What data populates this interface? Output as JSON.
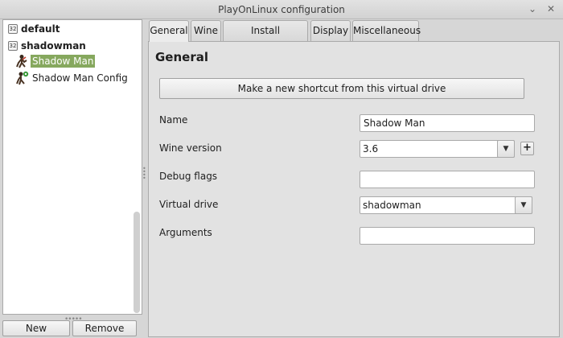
{
  "window": {
    "title": "PlayOnLinux configuration",
    "minimize_glyph": "⌄",
    "close_glyph": "✕"
  },
  "tree": {
    "prefixes": [
      {
        "label": "default",
        "arch_badge": "32"
      },
      {
        "label": "shadowman",
        "arch_badge": "32"
      }
    ],
    "items": [
      {
        "label": "Shadow Man",
        "icon": "shadow-man-game-icon",
        "selected": true
      },
      {
        "label": "Shadow Man Config",
        "icon": "shadow-man-config-icon",
        "selected": false
      }
    ]
  },
  "buttons": {
    "new": "New",
    "remove": "Remove"
  },
  "tabs": [
    {
      "label": "General",
      "active": true
    },
    {
      "label": "Wine",
      "active": false
    },
    {
      "label": "Install components",
      "active": false
    },
    {
      "label": "Display",
      "active": false
    },
    {
      "label": "Miscellaneous",
      "active": false
    }
  ],
  "general": {
    "title": "General",
    "shortcut_button": "Make a new shortcut from this virtual drive",
    "fields": {
      "name": {
        "label": "Name",
        "value": "Shadow Man"
      },
      "wine_version": {
        "label": "Wine version",
        "value": "3.6"
      },
      "debug_flags": {
        "label": "Debug flags",
        "value": ""
      },
      "virtual_drive": {
        "label": "Virtual drive",
        "value": "shadowman"
      },
      "arguments": {
        "label": "Arguments",
        "value": ""
      }
    },
    "add_wine_glyph": "+"
  },
  "colors": {
    "selection": "#86a85e"
  }
}
